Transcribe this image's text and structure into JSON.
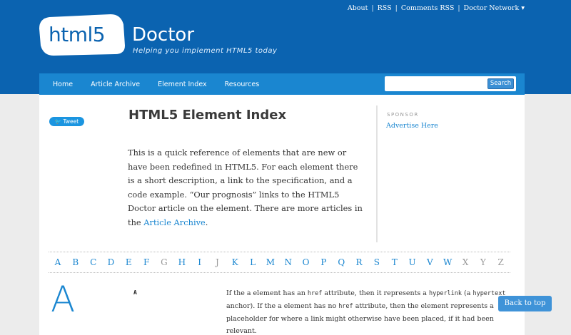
{
  "top_links": [
    "About",
    "RSS",
    "Comments RSS",
    "Doctor Network ▾"
  ],
  "logo": {
    "html5": "html5",
    "doctor": "Doctor",
    "tagline": "Helping you implement HTML5 today"
  },
  "nav": {
    "items": [
      "Home",
      "Article Archive",
      "Element Index",
      "Resources"
    ]
  },
  "search": {
    "button": "Search",
    "value": ""
  },
  "tweet": "Tweet",
  "page": {
    "title": "HTML5 Element Index",
    "intro_pre": "This is a quick reference of elements that are new or have been redefined in HTML5. For each element there is a short description, a link to the specification, and a code example. “Our prognosis” links to the HTML5 Doctor article on the element. There are more articles in the ",
    "intro_link": "Article Archive",
    "intro_post": "."
  },
  "sidebar": {
    "sponsor_label": "SPONSOR",
    "advertise": "Advertise Here"
  },
  "alphabet": [
    {
      "l": "A",
      "on": true
    },
    {
      "l": "B",
      "on": true
    },
    {
      "l": "C",
      "on": true
    },
    {
      "l": "D",
      "on": true
    },
    {
      "l": "E",
      "on": true
    },
    {
      "l": "F",
      "on": true
    },
    {
      "l": "G",
      "on": false
    },
    {
      "l": "H",
      "on": true
    },
    {
      "l": "I",
      "on": true
    },
    {
      "l": "J",
      "on": false
    },
    {
      "l": "K",
      "on": true
    },
    {
      "l": "L",
      "on": true
    },
    {
      "l": "M",
      "on": true
    },
    {
      "l": "N",
      "on": true
    },
    {
      "l": "O",
      "on": true
    },
    {
      "l": "P",
      "on": true
    },
    {
      "l": "Q",
      "on": true
    },
    {
      "l": "R",
      "on": true
    },
    {
      "l": "S",
      "on": true
    },
    {
      "l": "T",
      "on": true
    },
    {
      "l": "U",
      "on": true
    },
    {
      "l": "V",
      "on": true
    },
    {
      "l": "W",
      "on": true
    },
    {
      "l": "X",
      "on": false
    },
    {
      "l": "Y",
      "on": false
    },
    {
      "l": "Z",
      "on": false
    }
  ],
  "section": {
    "letter": "A",
    "element_name": "A",
    "desc_1": "If the a element has an ",
    "code_href": "href",
    "desc_2": " attribute, then it represents a ",
    "code_hyperlink": "hyperlink",
    "desc_3": " (a ",
    "code_hypertext": "hypertext",
    "desc_4": " anchor). If the a element has no ",
    "code_href2": "href",
    "desc_5": " attribute, then the element represents a placeholder for where a link might otherwise have been placed, if it had been relevant."
  },
  "back_to_top": "Back to top",
  "colors": {
    "brand_blue": "#0b63b0",
    "nav_blue": "#1a86d0"
  }
}
